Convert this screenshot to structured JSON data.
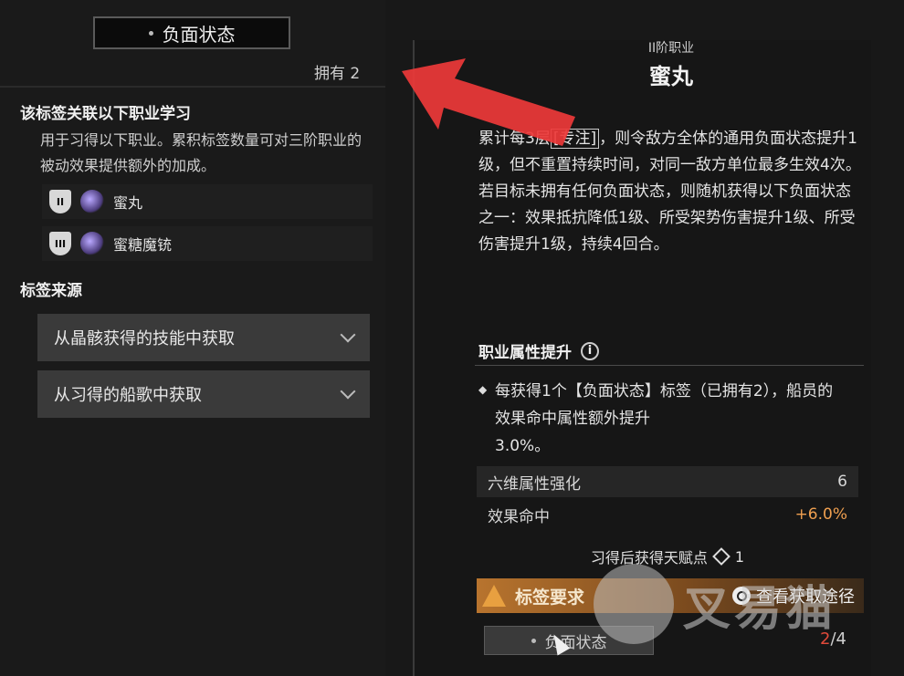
{
  "left": {
    "tag_name": "负面状态",
    "owned_label": "拥有 2",
    "linked_title": "该标签关联以下职业学习",
    "linked_desc": "用于习得以下职业。累积标签数量可对三阶职业的被动效果提供额外的加成。",
    "jobs": [
      {
        "rank": "II",
        "name": "蜜丸"
      },
      {
        "rank": "III",
        "name": "蜜糖魔铳"
      }
    ],
    "source_title": "标签来源",
    "sources": [
      "从晶骸获得的技能中获取",
      "从习得的船歌中获取"
    ]
  },
  "right": {
    "tier": "II阶职业",
    "title": "蜜丸",
    "effect_before": "累计每",
    "effect_hidden_gap": "3层",
    "effect_focus": "[专注]",
    "effect_after": "，则令敌方全体的通用负面状态提升1级，但不重置持续时间，对同一敌方单位最多生效4次。",
    "effect_p2": "若目标未拥有任何负面状态，则随机获得以下负面状态之一：效果抵抗降低1级、所受架势伤害提升1级、所受伤害提升1级，持续4回合。",
    "attr_title": "职业属性提升",
    "bonus_text": "每获得1个【负面状态】标签（已拥有2），船员的效果命中属性额外提升",
    "bonus_value": "3.0%。",
    "stats": [
      {
        "name": "六维属性强化",
        "value": "6"
      },
      {
        "name": "效果命中",
        "value": "+6.0%"
      }
    ],
    "talent_label": "习得后获得天赋点",
    "talent_value": "1",
    "req_label": "标签要求",
    "req_link": "查看获取途径",
    "req_slot": "负面状态",
    "req_have": "2",
    "req_total": "/4"
  },
  "colors": {
    "accent_orange": "#e8a040",
    "bonus_orange": "#f0a050",
    "req_red": "#e04a3a",
    "arrow_red": "#ee3a3a"
  },
  "watermark": "叉易猫"
}
